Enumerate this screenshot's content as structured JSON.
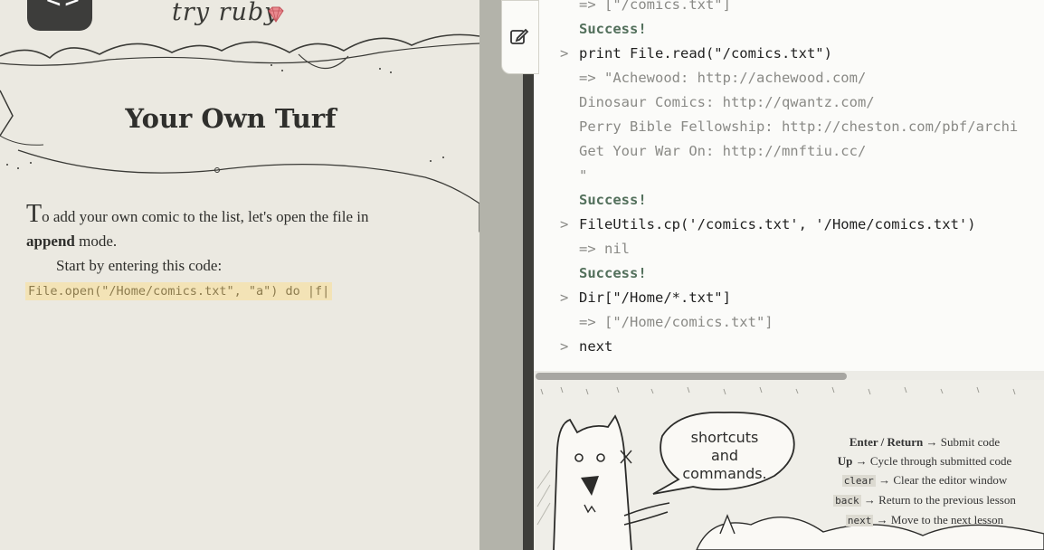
{
  "lesson": {
    "brand": "try ruby",
    "title": "Your Own Turf",
    "p1_dropcap": "T",
    "p1_before": "o add your own comic to the list, let's open the file in",
    "p1_bold": "append",
    "p1_after": " mode.",
    "p2": "Start by entering this code:",
    "code": "File.open(\"/Home/comics.txt\", \"a\") do |f|"
  },
  "console": {
    "prompt": ">",
    "result_prefix": "=>",
    "lines": [
      {
        "kind": "res",
        "text": "[\"/comics.txt\"]"
      },
      {
        "kind": "succ",
        "text": "Success!"
      },
      {
        "kind": "cmd",
        "text": "print File.read(\"/comics.txt\")"
      },
      {
        "kind": "res",
        "text": "\"Achewood: http://achewood.com/"
      },
      {
        "kind": "cont",
        "text": "Dinosaur Comics: http://qwantz.com/"
      },
      {
        "kind": "cont",
        "text": "Perry Bible Fellowship: http://cheston.com/pbf/archi"
      },
      {
        "kind": "cont",
        "text": "Get Your War On: http://mnftiu.cc/"
      },
      {
        "kind": "cont",
        "text": "\""
      },
      {
        "kind": "succ",
        "text": "Success!"
      },
      {
        "kind": "cmd",
        "text": "FileUtils.cp('/comics.txt', '/Home/comics.txt')"
      },
      {
        "kind": "res",
        "text": "nil"
      },
      {
        "kind": "succ",
        "text": "Success!"
      },
      {
        "kind": "cmd",
        "text": "Dir[\"/Home/*.txt\"]"
      },
      {
        "kind": "res",
        "text": "[\"/Home/comics.txt\"]"
      },
      {
        "kind": "cmd",
        "text": "next"
      }
    ]
  },
  "shortcuts": {
    "bubble_lines": [
      "shortcuts",
      "and",
      "commands."
    ],
    "arrow": "→",
    "items": [
      {
        "key": "Enter / Return",
        "style": "bold",
        "desc": "Submit code"
      },
      {
        "key": "Up",
        "style": "bold",
        "desc": "Cycle through submitted code"
      },
      {
        "key": "clear",
        "style": "code",
        "desc": "Clear the editor window"
      },
      {
        "key": "back",
        "style": "code",
        "desc": "Return to the previous lesson"
      },
      {
        "key": "next",
        "style": "code",
        "desc": "Move to the next lesson"
      }
    ]
  },
  "colors": {
    "paper": "#ebe9e1",
    "console_bg": "#fbfbf9",
    "success": "#53705c",
    "code_highlight": "#f3e3b6"
  },
  "icons": {
    "nav": "chevrons-icon",
    "gem": "ruby-gem-icon",
    "edit": "edit-icon"
  }
}
